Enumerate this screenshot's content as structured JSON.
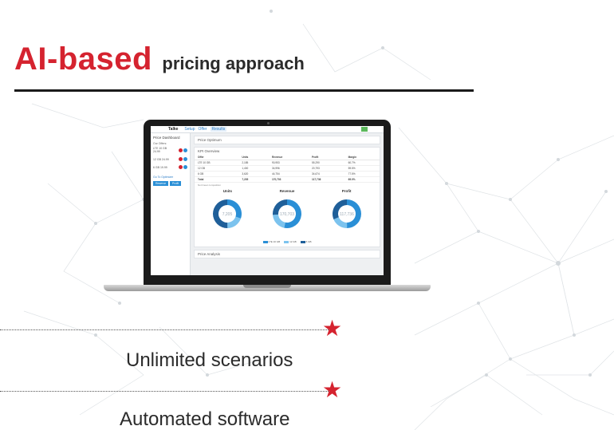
{
  "headline": {
    "accent": "AI-based",
    "rest": "pricing approach"
  },
  "app": {
    "brand": "Talke",
    "tabs": [
      "Setup",
      "Offer",
      "Results"
    ],
    "active_tab": "Results",
    "sidebar": {
      "title": "Price Dashboard",
      "subtitle": "Our Offers:",
      "offers": [
        "LTE 10 GB 24.99",
        "12 GB 24.99",
        "6 GB 19.99"
      ],
      "optimizer_link": "Go To Optimizer",
      "buttons": [
        "Reserve",
        "Profit"
      ]
    },
    "panels": {
      "optimum": "Price Optimum",
      "kpi": "KPI Overview",
      "analysis": "Price Analysis"
    },
    "kpi_table": {
      "columns": [
        "Offer",
        "Units",
        "Revenue",
        "Profit",
        "Margin"
      ],
      "rows": [
        [
          "LTE 10 GB",
          "2,185",
          "90,953",
          "55,290",
          "60.7%"
        ],
        [
          "12 GB",
          "1,400",
          "34,996",
          "20,793",
          "59.5%"
        ],
        [
          "6 GB",
          "3,620",
          "44,754",
          "34,674",
          "77.5%"
        ]
      ],
      "total": [
        "Total",
        "7,205",
        "170,703",
        "117,736",
        "69.0%"
      ],
      "note": "Not linear competition"
    },
    "donuts": [
      {
        "title": "Units",
        "center": "7,205"
      },
      {
        "title": "Revenue",
        "center": "170,703"
      },
      {
        "title": "Profit",
        "center": "117,736"
      }
    ],
    "legend": [
      "LTE 10 GB",
      "12 GB",
      "6 GB"
    ]
  },
  "chart_data": {
    "type": "pie",
    "donut": true,
    "series": [
      {
        "name": "Units",
        "values": [
          2185,
          1400,
          3620
        ]
      },
      {
        "name": "Revenue",
        "values": [
          90953,
          34996,
          44754
        ]
      },
      {
        "name": "Profit",
        "values": [
          55290,
          20793,
          34674
        ]
      }
    ],
    "categories": [
      "LTE 10 GB",
      "12 GB",
      "6 GB"
    ],
    "colors": [
      "#2a8fd6",
      "#7cc3ee",
      "#1f5f99"
    ]
  },
  "features": [
    {
      "label": "Unlimited scenarios"
    },
    {
      "label": "Automated software"
    }
  ],
  "colors": {
    "accent_red": "#d5232f",
    "app_blue": "#2a8fd6",
    "headline_dark": "#2b2b2b"
  },
  "icons": {
    "feature_marker": "star-icon"
  }
}
